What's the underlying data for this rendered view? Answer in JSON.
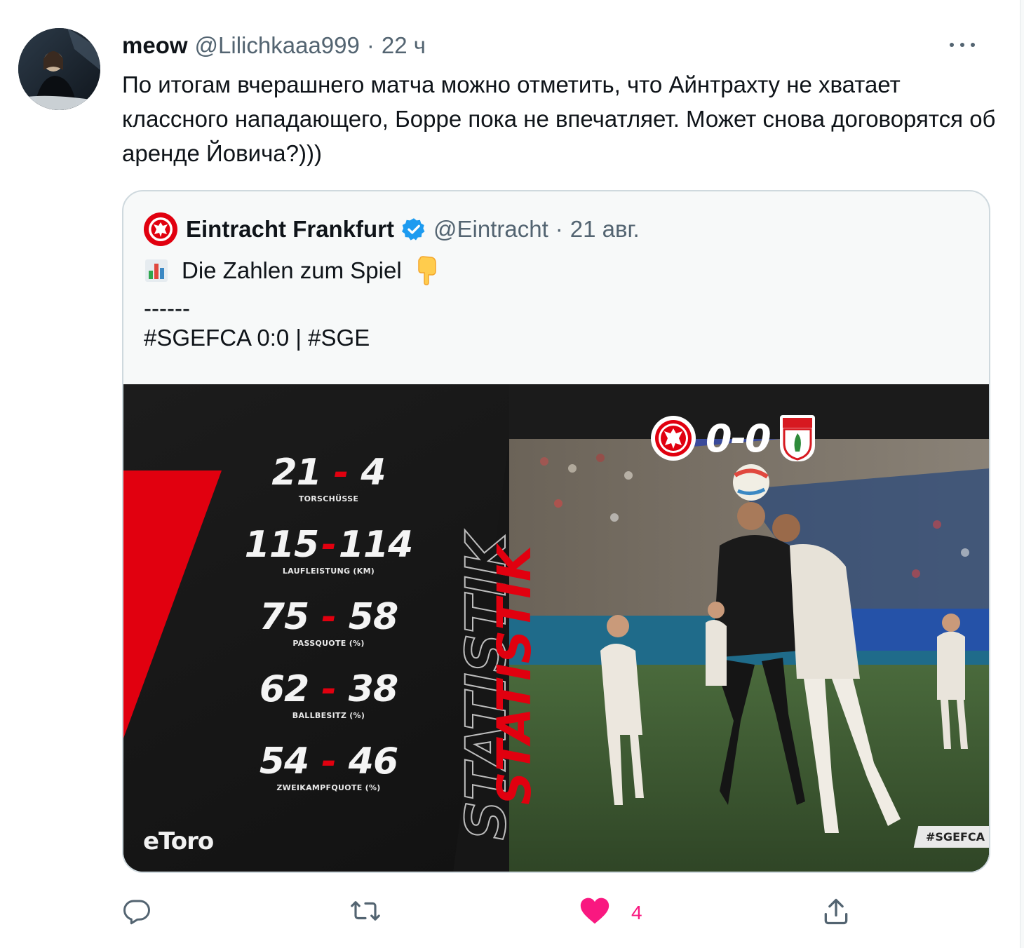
{
  "author": {
    "name": "meow",
    "handle": "@Lilichkaaa999",
    "separator": "·",
    "time": "22 ч"
  },
  "tweet_text": "По итогам вчерашнего матча можно отметить, что Айнтрахту не хватает классного нападающего, Борре пока не впечатляет. Может снова договорятся об аренде Йовича?)))",
  "quoted": {
    "name": "Eintracht Frankfurt",
    "handle": "@Eintracht",
    "separator": "·",
    "date": "21 авг.",
    "line1_text": "Die Zahlen zum Spiel",
    "line2": "------",
    "line3": "#SGEFCA 0:0 | #SGE",
    "media": {
      "vertical_title": "STATISTIK",
      "score": "0-0",
      "stats": [
        {
          "home": "21",
          "away": "4",
          "label": "TORSCHÜSSE"
        },
        {
          "home": "115",
          "away": "114",
          "label": "LAUFLEISTUNG (KM)"
        },
        {
          "home": "75",
          "away": "58",
          "label": "PASSQUOTE (%)"
        },
        {
          "home": "62",
          "away": "38",
          "label": "BALLBESITZ (%)"
        },
        {
          "home": "54",
          "away": "46",
          "label": "ZWEIKAMPFQUOTE (%)"
        }
      ],
      "sponsor": "eToro",
      "hashtag": "#SGEFCA",
      "dash": "-"
    }
  },
  "actions": {
    "like_count": "4"
  },
  "colors": {
    "like": "#f91880",
    "verified": "#1d9bf0",
    "eintracht_red": "#e1000f",
    "muted": "#536471"
  },
  "icons": [
    "more-icon",
    "reply-icon",
    "retweet-icon",
    "like-icon",
    "share-icon",
    "verified-icon",
    "bar-chart-emoji",
    "point-down-emoji"
  ]
}
